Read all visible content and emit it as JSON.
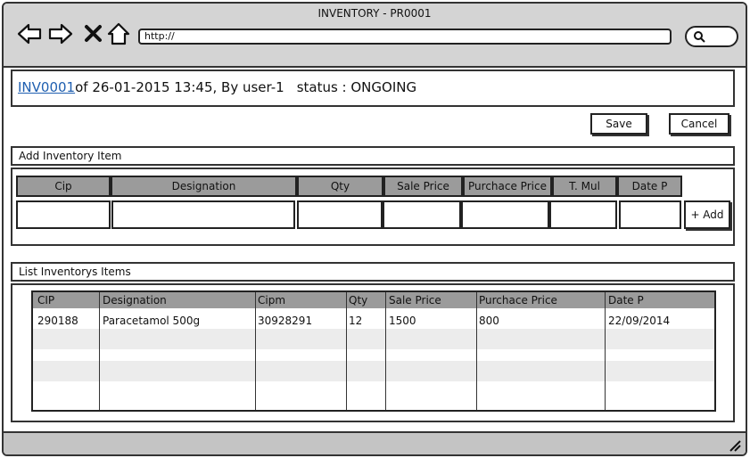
{
  "window": {
    "title": "INVENTORY - PR0001",
    "url": "http://"
  },
  "header": {
    "inventory_id": "INV0001",
    "meta": "of 26-01-2015 13:45, By user-1",
    "status": "status : ONGOING"
  },
  "actions": {
    "save_label": "Save",
    "cancel_label": "Cancel"
  },
  "add_section": {
    "title": "Add Inventory Item",
    "columns": [
      "Cip",
      "Designation",
      "Qty",
      "Sale Price",
      "Purchace Price",
      "T. Mul",
      "Date P"
    ],
    "add_label": "+ Add"
  },
  "list_section": {
    "title": "List Inventorys Items",
    "columns": [
      "CIP",
      "Designation",
      "Cipm",
      "Qty",
      "Sale Price",
      "Purchace Price",
      "Date P"
    ],
    "rows": [
      [
        "290188",
        "Paracetamol 500g",
        "30928291",
        "12",
        "1500",
        "800",
        "22/09/2014"
      ]
    ]
  },
  "icons": [
    "back-arrow-icon",
    "forward-arrow-icon",
    "close-icon",
    "home-icon",
    "search-icon",
    "resize-grip-icon"
  ]
}
